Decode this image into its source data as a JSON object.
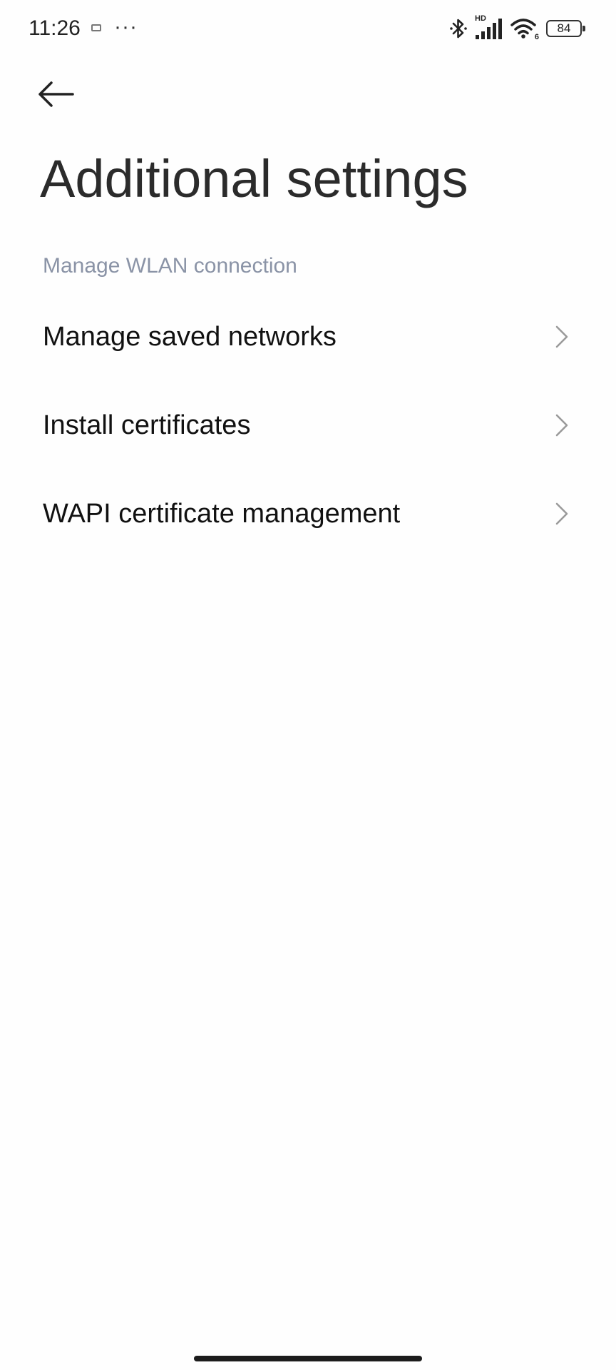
{
  "status_bar": {
    "time": "11:26",
    "more": "···",
    "battery": "84",
    "network_label": "HD",
    "wifi_label": "6",
    "icons": [
      "notification-icon",
      "bluetooth-icon",
      "signal-icon",
      "wifi-icon",
      "battery-icon"
    ]
  },
  "header": {
    "back_icon": "back-arrow-icon",
    "title": "Additional settings"
  },
  "section": {
    "header": "Manage WLAN connection",
    "items": [
      {
        "label": "Manage saved networks",
        "icon": "chevron-right-icon"
      },
      {
        "label": "Install certificates",
        "icon": "chevron-right-icon"
      },
      {
        "label": "WAPI certificate management",
        "icon": "chevron-right-icon"
      }
    ]
  },
  "colors": {
    "background": "#fefefe",
    "section_header": "#8a93a6",
    "text": "#111111",
    "chevron": "#9a9a9a"
  }
}
